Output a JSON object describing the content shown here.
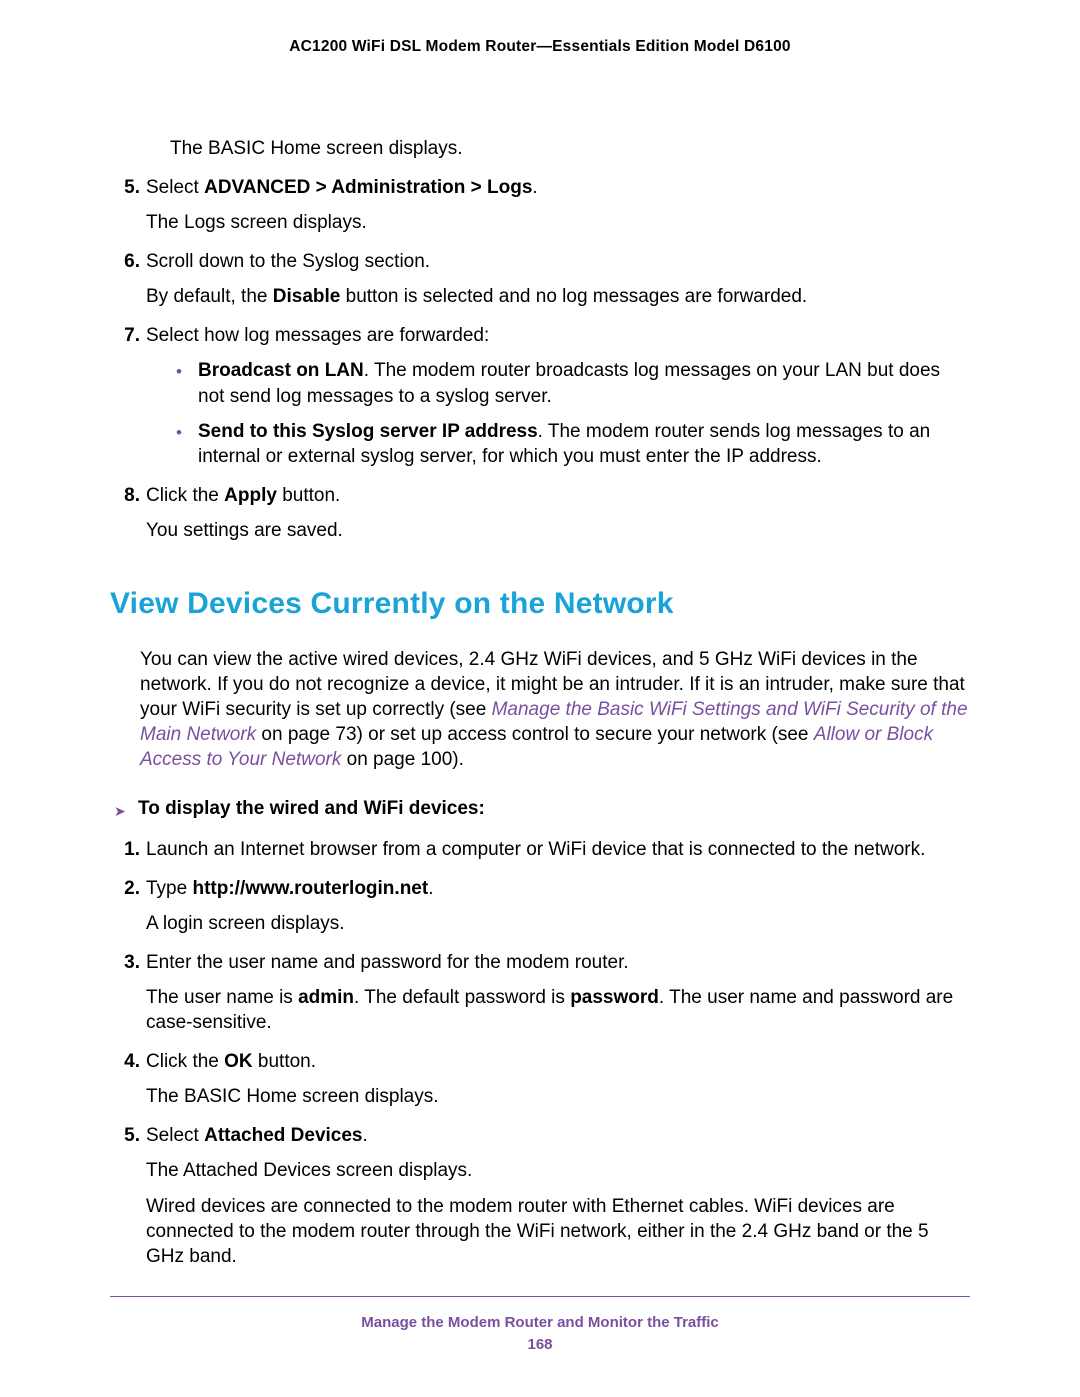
{
  "header": {
    "doc_title": "AC1200 WiFi DSL Modem Router—Essentials Edition Model D6100"
  },
  "top_section": {
    "preline": "The BASIC Home screen displays.",
    "items": [
      {
        "num": "5.",
        "lead_a": "Select ",
        "lead_b": "ADVANCED > Administration > Logs",
        "lead_c": ".",
        "sub": "The Logs screen displays."
      },
      {
        "num": "6.",
        "lead_a": "Scroll down to the Syslog section.",
        "sub_a": "By default, the ",
        "sub_b": "Disable",
        "sub_c": " button is selected and no log messages are forwarded."
      },
      {
        "num": "7.",
        "lead_a": "Select how log messages are forwarded:",
        "bullets": [
          {
            "bold": "Broadcast on LAN",
            "rest": ". The modem router broadcasts log messages on your LAN but does not send log messages to a syslog server."
          },
          {
            "bold": "Send to this Syslog server IP address",
            "rest": ". The modem router sends log messages to an internal or external syslog server, for which you must enter the IP address."
          }
        ]
      },
      {
        "num": "8.",
        "lead_a": "Click the ",
        "lead_b": "Apply",
        "lead_c": " button.",
        "sub": "You settings are saved."
      }
    ]
  },
  "section_heading": "View Devices Currently on the Network",
  "intro": {
    "part1": "You can view the active wired devices, 2.4 GHz WiFi devices, and 5 GHz WiFi devices in the network. If you do not recognize a device, it might be an intruder. If it is an intruder, make sure that your WiFi security is set up correctly (see ",
    "link1": "Manage the Basic WiFi Settings and WiFi Security of the Main Network",
    "part2": " on page 73) or set up access control to secure your network (see ",
    "link2": "Allow or Block Access to Your Network",
    "part3": " on page 100)."
  },
  "proc_heading": "To display the wired and WiFi devices:",
  "proc_items": [
    {
      "num": "1.",
      "text": "Launch an Internet browser from a computer or WiFi device that is connected to the network."
    },
    {
      "num": "2.",
      "lead_a": "Type ",
      "lead_b": "http://www.routerlogin.net",
      "lead_c": ".",
      "sub": "A login screen displays."
    },
    {
      "num": "3.",
      "text": "Enter the user name and password for the modem router.",
      "sub_a": "The user name is ",
      "sub_b": "admin",
      "sub_c": ". The default password is ",
      "sub_d": "password",
      "sub_e": ". The user name and password are case-sensitive."
    },
    {
      "num": "4.",
      "lead_a": "Click the ",
      "lead_b": "OK",
      "lead_c": " button.",
      "sub": "The BASIC Home screen displays."
    },
    {
      "num": "5.",
      "lead_a": "Select ",
      "lead_b": "Attached Devices",
      "lead_c": ".",
      "sub": "The Attached Devices screen displays.",
      "sub2": "Wired devices are connected to the modem router with Ethernet cables. WiFi devices are connected to the modem router through the WiFi network, either in the 2.4 GHz band or the 5 GHz band."
    }
  ],
  "footer": {
    "chapter": "Manage the Modem Router and Monitor the Traffic",
    "page": "168"
  }
}
